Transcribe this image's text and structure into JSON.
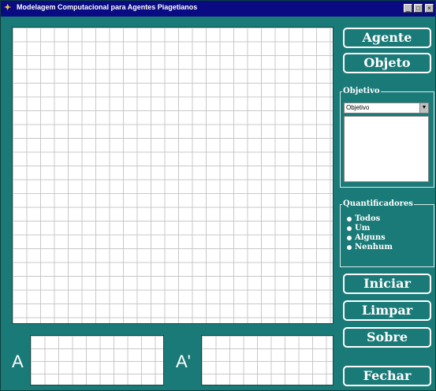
{
  "window": {
    "title": "Modelagem Computacional para Agentes Piagetianos",
    "app_icon": "app-logo-icon",
    "controls": [
      "minimize-icon",
      "maximize-icon",
      "close-icon"
    ]
  },
  "buttons": {
    "agente": "Agente",
    "objeto": "Objeto",
    "iniciar": "Iniciar",
    "limpar": "Limpar",
    "sobre": "Sobre",
    "fechar": "Fechar"
  },
  "objetivo": {
    "title": "Objetivo",
    "selected": "Objetivo",
    "list_items": []
  },
  "quantificadores": {
    "title": "Quantificadores",
    "options": [
      "Todos",
      "Um",
      "Alguns",
      "Nenhum"
    ]
  },
  "mini_grids": {
    "a_label": "A",
    "a_prime_label": "A'"
  },
  "colors": {
    "window_bg": "#1a7a78",
    "title_bar": "#0a0a82",
    "grid_line": "#c8c8c8"
  }
}
